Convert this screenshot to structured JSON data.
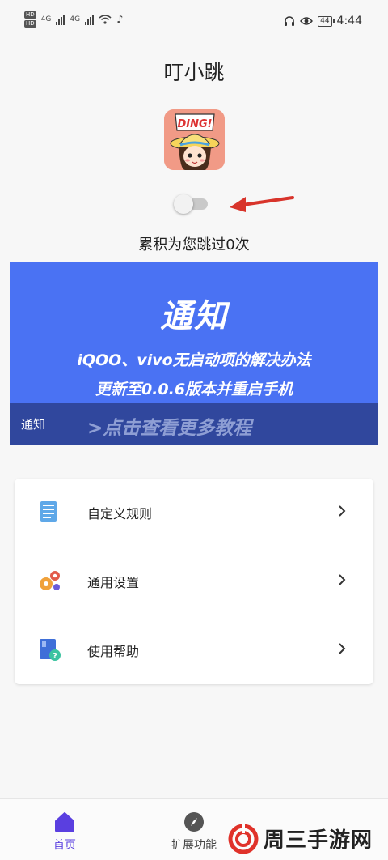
{
  "status_bar": {
    "hd_badges": [
      "HD",
      "HD"
    ],
    "network_labels": [
      "4G",
      "4G"
    ],
    "battery": "44",
    "time": "4:44",
    "icons": [
      "signal-icon",
      "wifi-icon",
      "music-icon",
      "headphones-icon",
      "eye-icon",
      "battery-icon"
    ]
  },
  "header": {
    "title": "叮小跳"
  },
  "app_icon": {
    "caption": "DING!"
  },
  "service_toggle": {
    "on": false
  },
  "skip_counter": "累积为您跳过0次",
  "banner": {
    "title": "通知",
    "line1": "iQOO、vivo无启动项的解决办法",
    "line2": "更新至0.0.6版本并重启手机",
    "tag": "通知",
    "link": ">点击查看更多教程",
    "colors": {
      "background": "#4a72f3",
      "footer": "#30479d"
    }
  },
  "menu": {
    "items": [
      {
        "label": "自定义规则",
        "icon": "document-list-icon"
      },
      {
        "label": "通用设置",
        "icon": "gears-icon"
      },
      {
        "label": "使用帮助",
        "icon": "help-book-icon"
      }
    ]
  },
  "bottom_nav": {
    "items": [
      {
        "label": "首页",
        "icon": "home-icon",
        "active": true
      },
      {
        "label": "扩展功能",
        "icon": "compass-icon",
        "active": false
      }
    ],
    "accent": "#5a3fe0"
  },
  "watermark": {
    "text": "周三手游网"
  }
}
